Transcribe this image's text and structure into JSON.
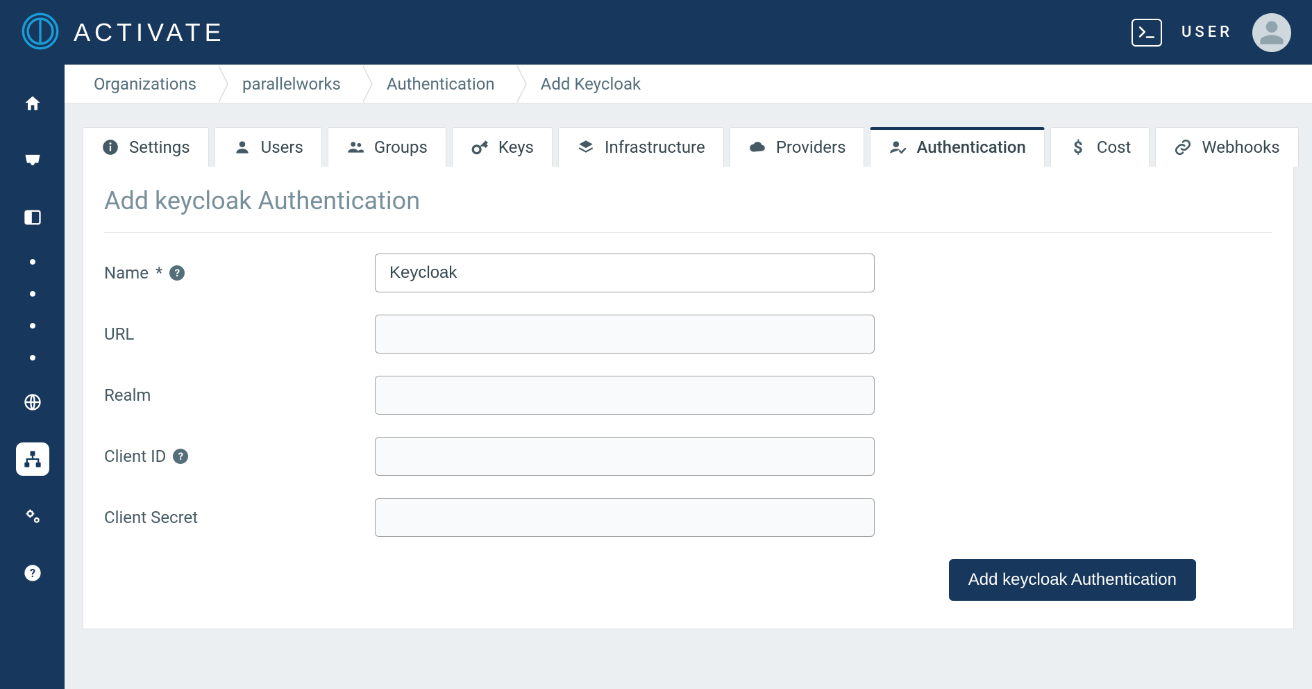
{
  "header": {
    "brand": "ACTIVATE",
    "user_label": "USER"
  },
  "breadcrumbs": [
    "Organizations",
    "parallelworks",
    "Authentication",
    "Add Keycloak"
  ],
  "tabs": [
    {
      "icon": "info",
      "label": "Settings"
    },
    {
      "icon": "user",
      "label": "Users"
    },
    {
      "icon": "users",
      "label": "Groups"
    },
    {
      "icon": "key",
      "label": "Keys"
    },
    {
      "icon": "layers",
      "label": "Infrastructure"
    },
    {
      "icon": "cloud",
      "label": "Providers"
    },
    {
      "icon": "user-check",
      "label": "Authentication",
      "active": true
    },
    {
      "icon": "dollar",
      "label": "Cost"
    },
    {
      "icon": "link",
      "label": "Webhooks"
    }
  ],
  "panel": {
    "title": "Add keycloak Authentication",
    "fields": {
      "name": {
        "label": "Name",
        "required": true,
        "help": true,
        "value": "Keycloak"
      },
      "url": {
        "label": "URL",
        "value": ""
      },
      "realm": {
        "label": "Realm",
        "value": ""
      },
      "client_id": {
        "label": "Client ID",
        "help": true,
        "value": ""
      },
      "client_secret": {
        "label": "Client Secret",
        "value": ""
      }
    },
    "submit_label": "Add keycloak Authentication"
  }
}
